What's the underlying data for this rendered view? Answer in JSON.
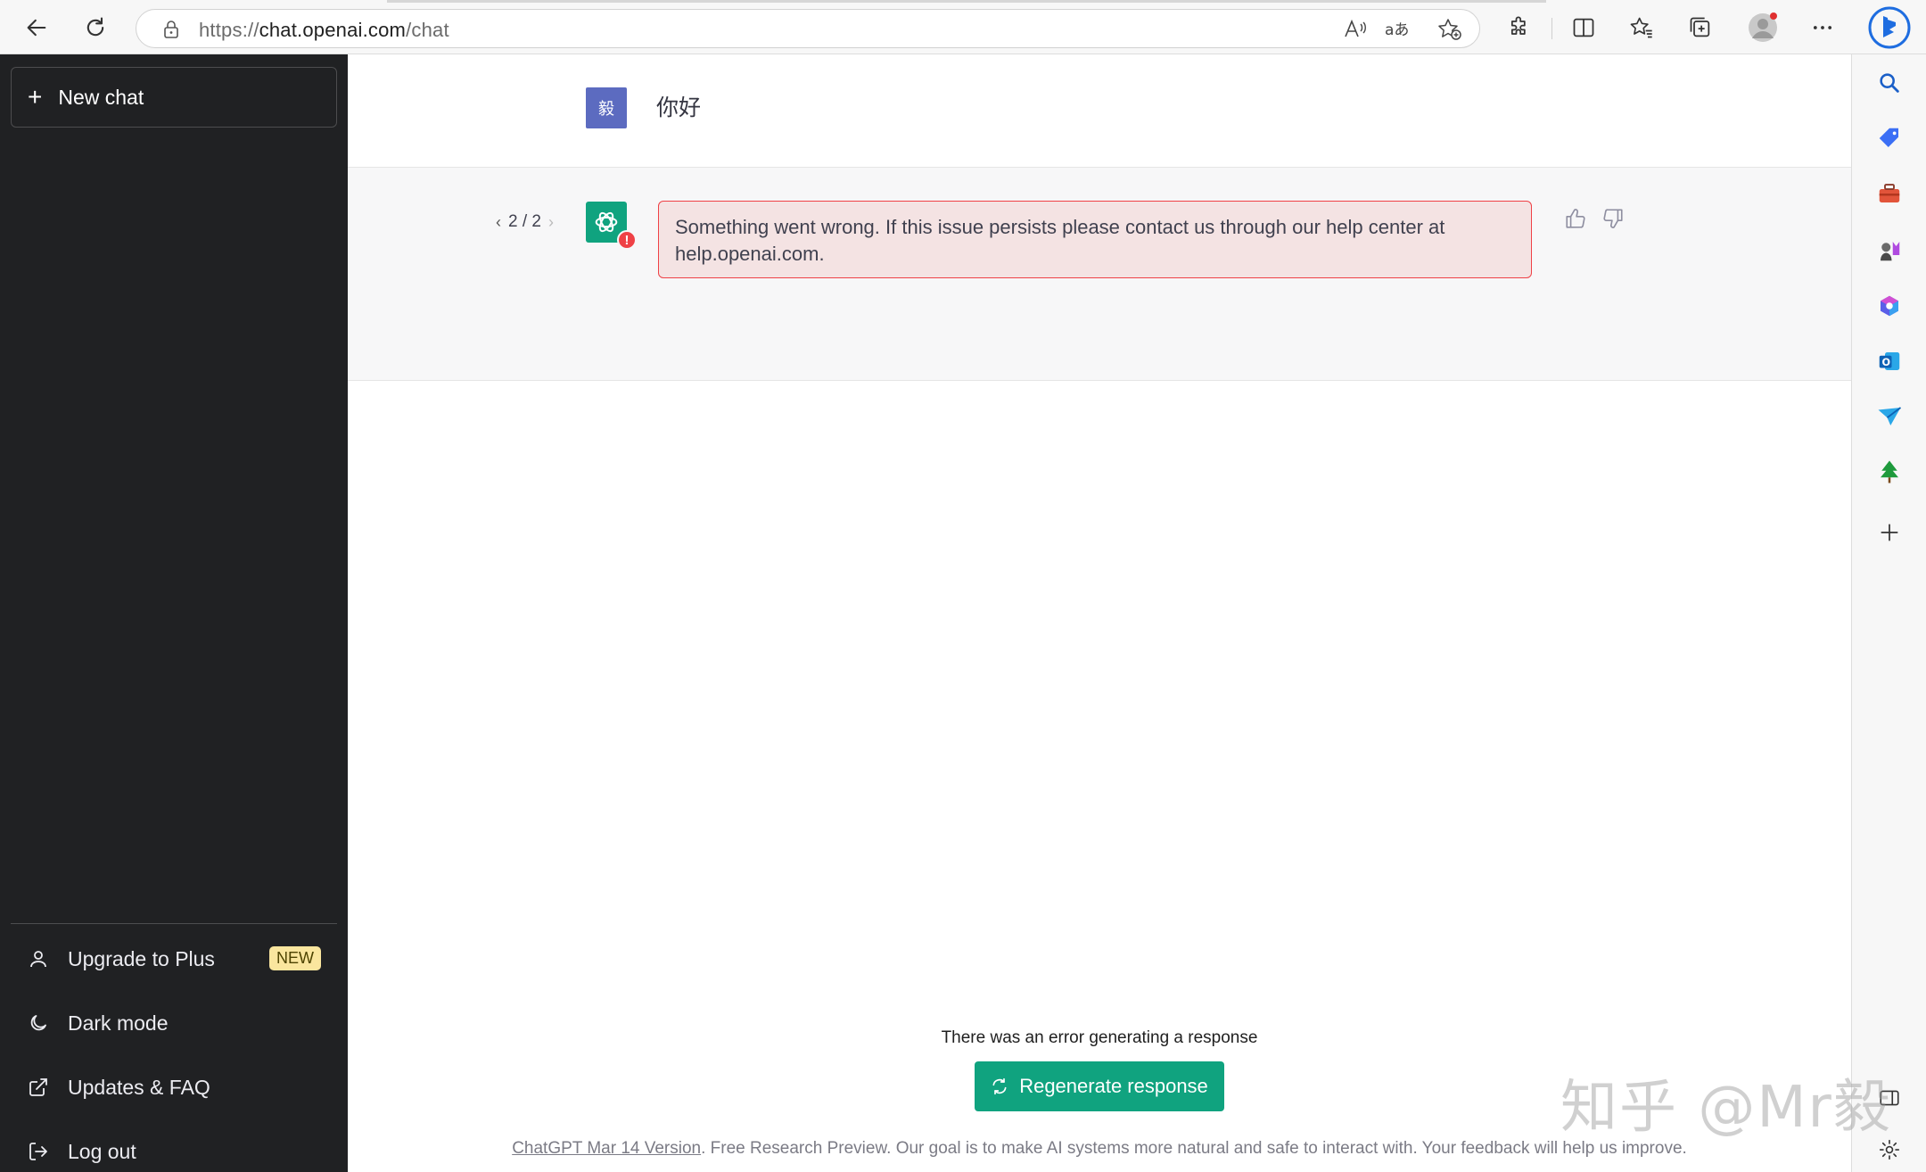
{
  "browser": {
    "url_scheme": "https://",
    "url_host": "chat.openai.com",
    "url_path": "/chat"
  },
  "sidebar": {
    "new_chat_label": "New chat",
    "items": [
      {
        "label": "Upgrade to Plus",
        "badge": "NEW",
        "icon": "user-icon"
      },
      {
        "label": "Dark mode",
        "icon": "moon-icon"
      },
      {
        "label": "Updates & FAQ",
        "icon": "external-link-icon"
      },
      {
        "label": "Log out",
        "icon": "logout-icon"
      }
    ]
  },
  "conversation": {
    "user_avatar_text": "毅",
    "user_message": "你好",
    "pager": "2 / 2",
    "error_message": "Something went wrong. If this issue persists please contact us through our help center at help.openai.com."
  },
  "bottom": {
    "error_notice": "There was an error generating a response",
    "regenerate_label": "Regenerate response",
    "footer_version": "ChatGPT Mar 14 Version",
    "footer_text": ". Free Research Preview. Our goal is to make AI systems more natural and safe to interact with. Your feedback will help us improve."
  },
  "watermark": "知乎 @Mr毅",
  "colors": {
    "sidebar_bg": "#202123",
    "accent": "#10a37f",
    "error_border": "#ef4146",
    "error_bg": "#f4e3e3",
    "user_avatar": "#5c6bc0"
  }
}
